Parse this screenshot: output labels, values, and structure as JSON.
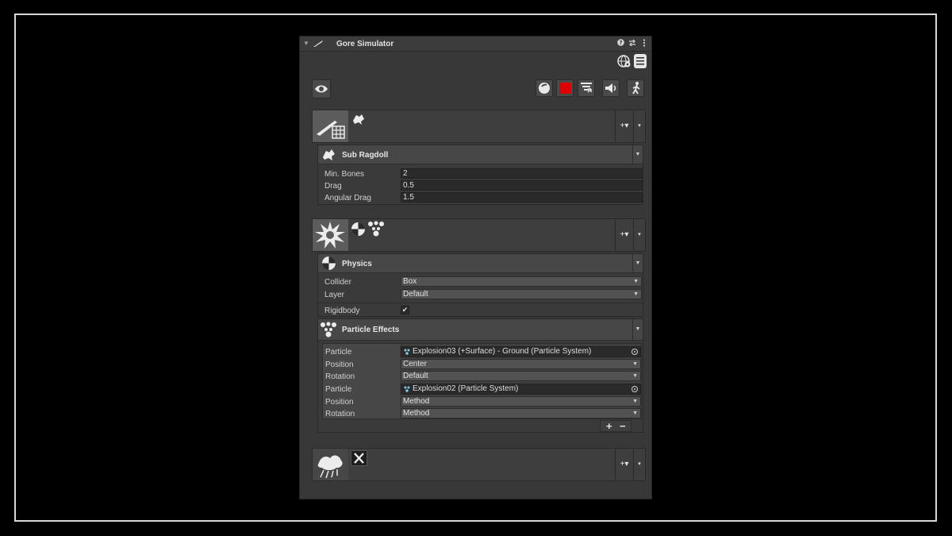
{
  "window": {
    "title": "Gore Simulator",
    "help_icon": "help-icon",
    "preset_icon": "presets-icon",
    "menu_icon": "kebab-menu-icon"
  },
  "toolbar_top": {
    "icons": [
      "globe-settings-icon",
      "document-icon"
    ]
  },
  "toolbar": {
    "visibility_icon": "eye-icon",
    "right_icons": [
      "sphere-icon",
      "color-swatch-icon",
      "list-filter-icon",
      "audio-icon",
      "ragdoll-person-icon"
    ],
    "swatch_color": "#e10000"
  },
  "groups": [
    {
      "id": "slice",
      "add_label": "+▾",
      "caret": "▾"
    },
    {
      "id": "explosion",
      "add_label": "+▾",
      "caret": "▾"
    },
    {
      "id": "bottom",
      "add_label": "+▾",
      "caret": "▾"
    }
  ],
  "sub_ragdoll": {
    "title": "Sub Ragdoll",
    "fields": [
      {
        "label": "Min. Bones",
        "value": "2"
      },
      {
        "label": "Drag",
        "value": "0.5"
      },
      {
        "label": "Angular Drag",
        "value": "1.5"
      }
    ]
  },
  "physics": {
    "title": "Physics",
    "collider_label": "Collider",
    "collider_value": "Box",
    "layer_label": "Layer",
    "layer_value": "Default",
    "rigidbody_label": "Rigidbody",
    "rigidbody_checked": "✔"
  },
  "particle_effects": {
    "title": "Particle Effects",
    "entries": [
      {
        "particle_label": "Particle",
        "particle_value": "Explosion03 (+Surface) - Ground (Particle System)",
        "position_label": "Position",
        "position_value": "Center",
        "rotation_label": "Rotation",
        "rotation_value": "Default"
      },
      {
        "particle_label": "Particle",
        "particle_value": "Explosion02 (Particle System)",
        "position_label": "Position",
        "position_value": "Method",
        "rotation_label": "Rotation",
        "rotation_value": "Method"
      }
    ],
    "add_label": "+",
    "remove_label": "−"
  }
}
